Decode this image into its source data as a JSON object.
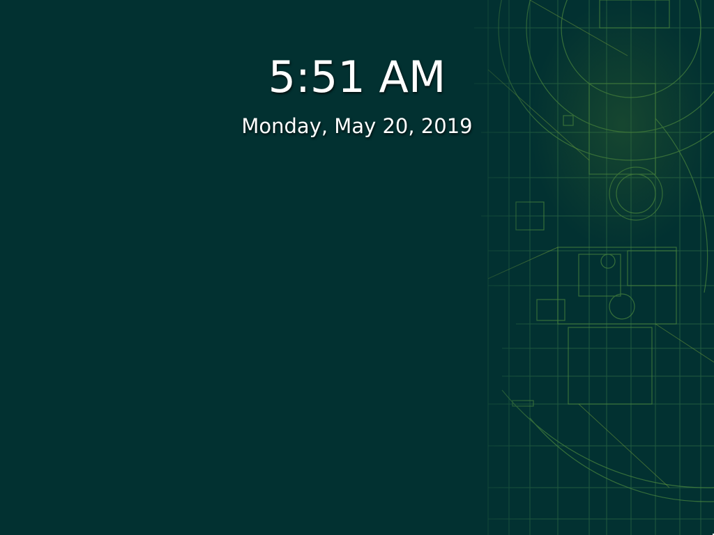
{
  "lock_screen": {
    "time": "5:51 AM",
    "date": "Monday, May 20, 2019"
  },
  "colors": {
    "background": "#023131",
    "blueprint_line": "#2f6b3e",
    "blueprint_highlight": "#6f9a3a",
    "text": "#ffffff"
  }
}
